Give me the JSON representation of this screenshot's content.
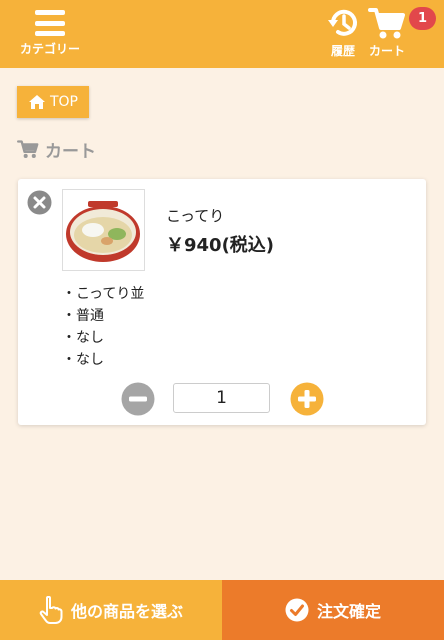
{
  "header": {
    "menu_label": "カテゴリー",
    "history_label": "履歴",
    "cart_label": "カート",
    "cart_count": "1"
  },
  "nav": {
    "top_label": "TOP"
  },
  "page": {
    "title": "カート"
  },
  "cart_item": {
    "name": "こってり",
    "price": "￥940(税込)",
    "options": [
      "・こってり並",
      "・普通",
      "・なし",
      "・なし"
    ],
    "quantity": "1"
  },
  "footer": {
    "other_label": "他の商品を選ぶ",
    "order_label": "注文確定"
  },
  "colors": {
    "header_bg": "#f6b23a",
    "badge": "#e2474b",
    "order_button": "#ec7b2a",
    "background": "#fcf1e4"
  }
}
